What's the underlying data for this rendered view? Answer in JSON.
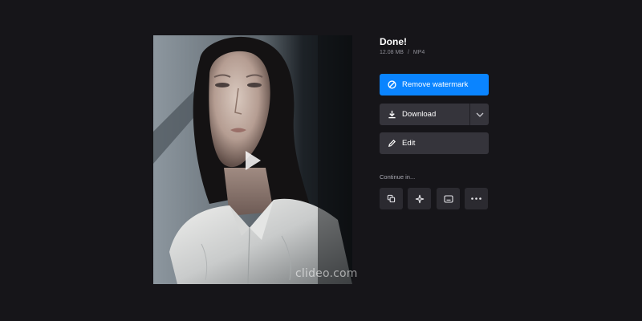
{
  "preview": {
    "watermark": "clideo.com"
  },
  "status": {
    "title": "Done!",
    "file_size": "12.08 MB",
    "separator": "/",
    "format": "MP4"
  },
  "actions": {
    "remove_watermark_label": "Remove watermark",
    "download_label": "Download",
    "edit_label": "Edit"
  },
  "continue": {
    "label": "Continue in...",
    "tools": [
      {
        "icon": "merge-icon"
      },
      {
        "icon": "sparkle-icon"
      },
      {
        "icon": "subtitles-icon"
      },
      {
        "icon": "more-icon"
      }
    ]
  },
  "colors": {
    "background": "#161519",
    "primary": "#0a84ff",
    "button": "#35343b",
    "tool_button": "#2b2a30",
    "muted_text": "#8d8d95"
  }
}
